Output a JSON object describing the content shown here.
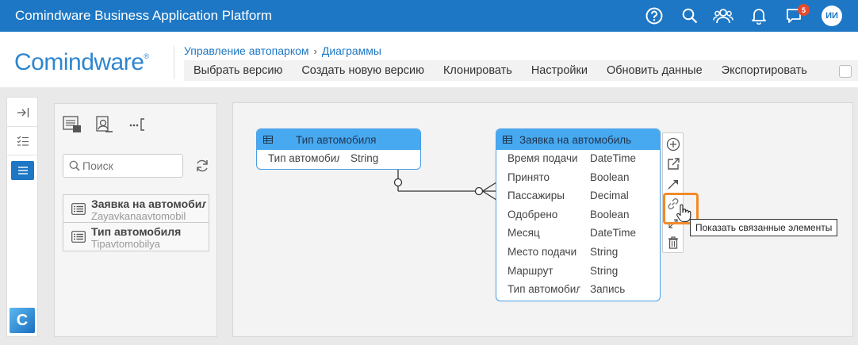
{
  "topbar": {
    "title": "Comindware Business Application Platform",
    "notification_count": "5",
    "avatar_initials": "ИИ"
  },
  "header": {
    "logo_text": "Comindware",
    "logo_mark": "®",
    "breadcrumb": [
      "Управление автопарком",
      "Диаграммы"
    ],
    "toolbar": [
      "Выбрать версию",
      "Создать новую версию",
      "Клонировать",
      "Настройки",
      "Обновить данные",
      "Экспортировать"
    ]
  },
  "strip": {
    "logo_letter": "C"
  },
  "panel": {
    "search_placeholder": "Поиск",
    "items": [
      {
        "title": "Заявка на автомобиль",
        "subtitle": "Zayavkanaavtomobil"
      },
      {
        "title": "Тип автомобиля",
        "subtitle": "Tipavtomobilya"
      }
    ]
  },
  "diagram": {
    "entities": [
      {
        "title": "Тип автомобиля",
        "rows": [
          {
            "name": "Тип автомобиля",
            "type": "String"
          }
        ]
      },
      {
        "title": "Заявка на автомобиль",
        "rows": [
          {
            "name": "Время подачи",
            "type": "DateTime"
          },
          {
            "name": "Принято",
            "type": "Boolean"
          },
          {
            "name": "Пассажиры",
            "type": "Decimal"
          },
          {
            "name": "Одобрено",
            "type": "Boolean"
          },
          {
            "name": "Месяц",
            "type": "DateTime"
          },
          {
            "name": "Место подачи",
            "type": "String"
          },
          {
            "name": "Маршрут",
            "type": "String"
          },
          {
            "name": "Тип автомобиля",
            "type": "Запись"
          }
        ]
      }
    ],
    "tooltip": "Показать связанные элементы"
  },
  "colors": {
    "accent": "#1d77c4",
    "entity_header": "#47a9f0",
    "highlight": "#f28a2a",
    "badge": "#e64a2e"
  }
}
